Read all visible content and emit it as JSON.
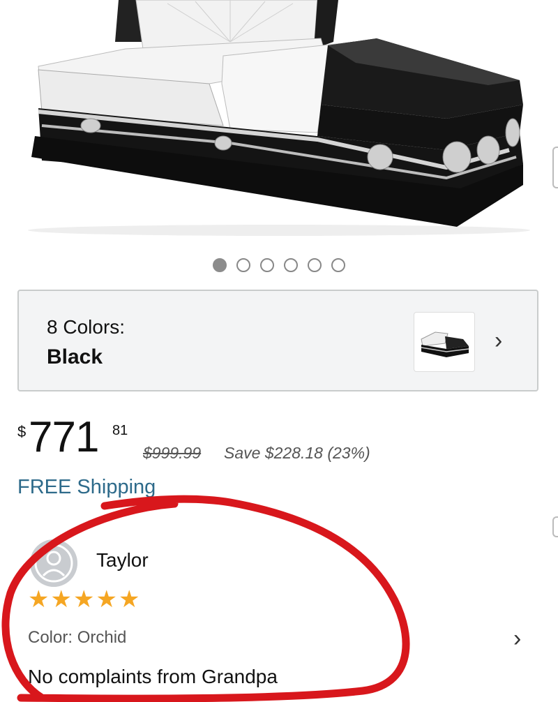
{
  "product": {
    "image_name": "casket-black-open"
  },
  "carousel": {
    "total": 6,
    "active_index": 0
  },
  "color_selector": {
    "count_label": "8 Colors:",
    "selected": "Black"
  },
  "price": {
    "currency": "$",
    "whole": "771",
    "fraction": "81",
    "list_price": "$999.99",
    "savings": "Save $228.18 (23%)"
  },
  "shipping": {
    "label": "FREE Shipping"
  },
  "review": {
    "reviewer": "Taylor",
    "rating": 5,
    "rating_max": 5,
    "color": "Color: Orchid",
    "text": "No complaints from Grandpa"
  },
  "colors": {
    "link": "#2d6a8a",
    "star": "#f5a623",
    "annotation": "#d8171c",
    "panel_bg": "#f3f4f5"
  }
}
